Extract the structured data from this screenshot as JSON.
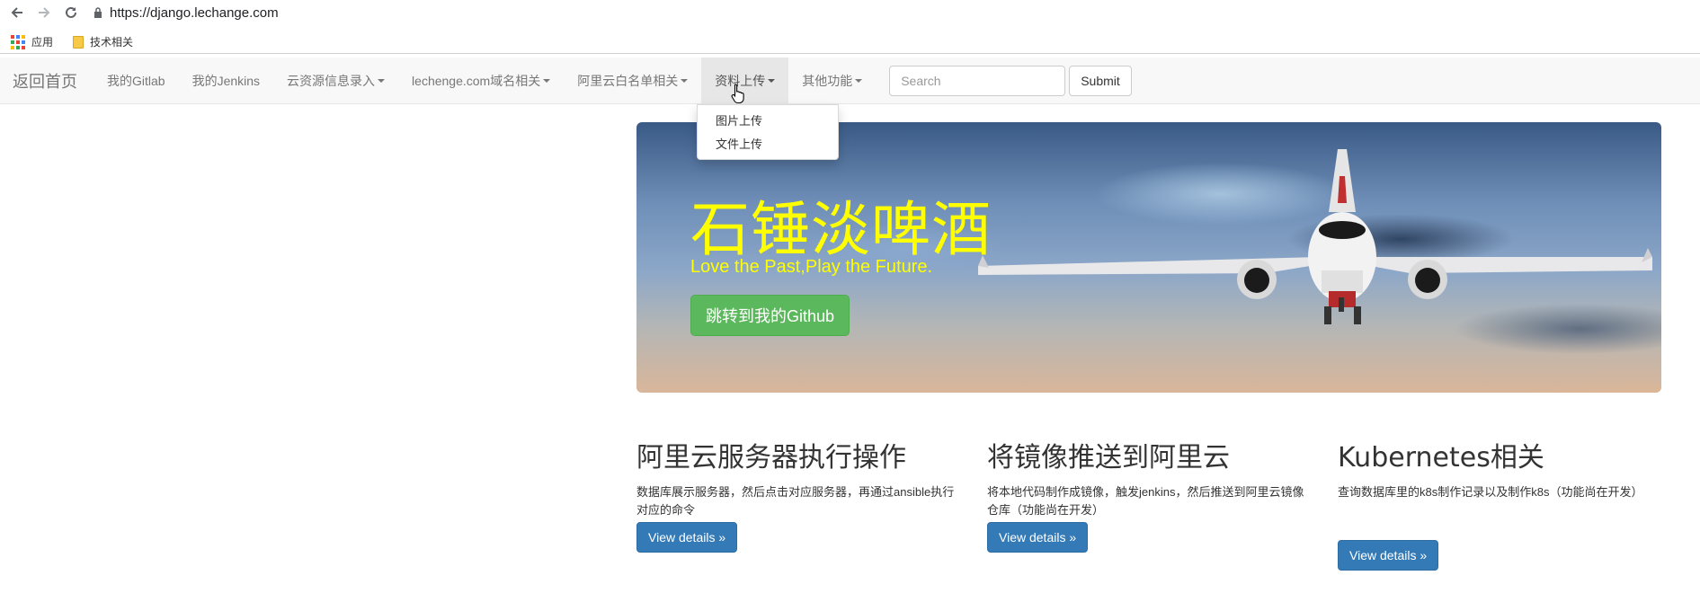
{
  "browser": {
    "url": "https://django.lechange.com",
    "bookmarks": [
      {
        "label": "应用"
      },
      {
        "label": "技术相关"
      }
    ]
  },
  "navbar": {
    "brand": "返回首页",
    "items": [
      {
        "label": "我的Gitlab",
        "dropdown": false
      },
      {
        "label": "我的Jenkins",
        "dropdown": false
      },
      {
        "label": "云资源信息录入",
        "dropdown": true
      },
      {
        "label": "lechenge.com域名相关",
        "dropdown": true
      },
      {
        "label": "阿里云白名单相关",
        "dropdown": true
      },
      {
        "label": "资料上传",
        "dropdown": true,
        "active": true
      },
      {
        "label": "其他功能",
        "dropdown": true
      }
    ],
    "search_placeholder": "Search",
    "submit_label": "Submit"
  },
  "dropdown": {
    "items": [
      {
        "label": "图片上传"
      },
      {
        "label": "文件上传"
      }
    ]
  },
  "jumbotron": {
    "title": "石锤淡啤酒",
    "subtitle": "Love the Past,Play the Future.",
    "button_label": "跳转到我的Github",
    "colors": {
      "title": "#ffff00",
      "button": "#5cb85c"
    }
  },
  "columns": [
    {
      "heading": "阿里云服务器执行操作",
      "text": "数据库展示服务器，然后点击对应服务器，再通过ansible执行对应的命令",
      "button_label": "View details »"
    },
    {
      "heading": "将镜像推送到阿里云",
      "text": "将本地代码制作成镜像，触发jenkins，然后推送到阿里云镜像仓库（功能尚在开发）",
      "button_label": "View details »"
    },
    {
      "heading": "Kubernetes相关",
      "text": "查询数据库里的k8s制作记录以及制作k8s（功能尚在开发）",
      "button_label": "View details »"
    }
  ]
}
